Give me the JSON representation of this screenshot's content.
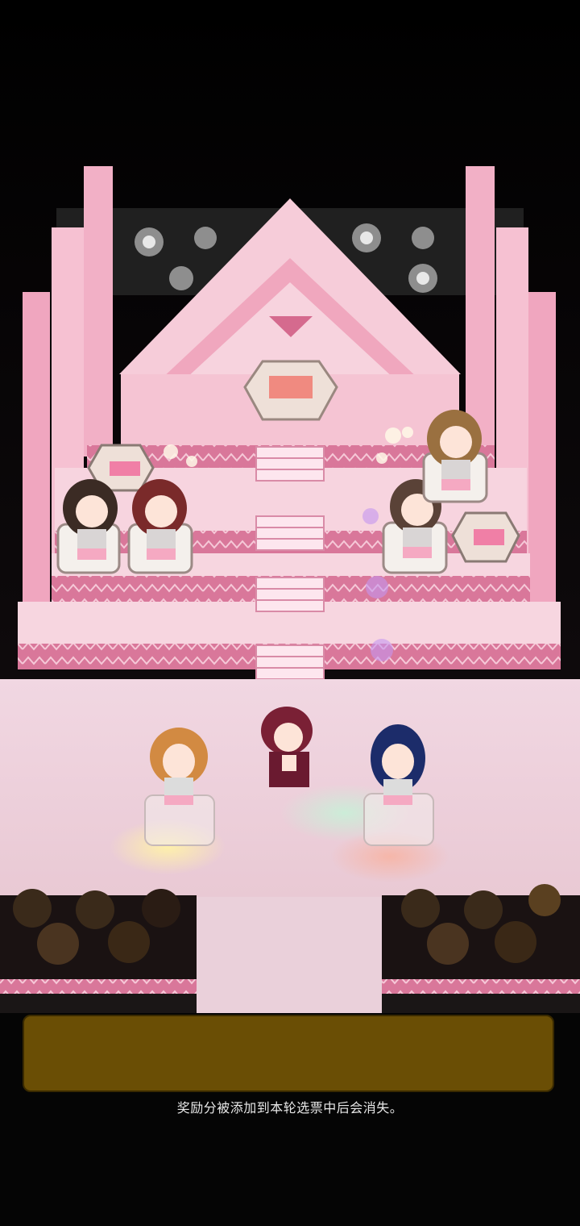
{
  "dialog": {
    "text": "",
    "background_color": "#6a4e05"
  },
  "caption": {
    "text": "奖励分被添加到本轮选票中后会消失。"
  },
  "colors": {
    "stage_pink": "#f3b6c9",
    "stage_dark_pink": "#d8708f",
    "floor": "#f1d5df",
    "background": "#050505"
  }
}
